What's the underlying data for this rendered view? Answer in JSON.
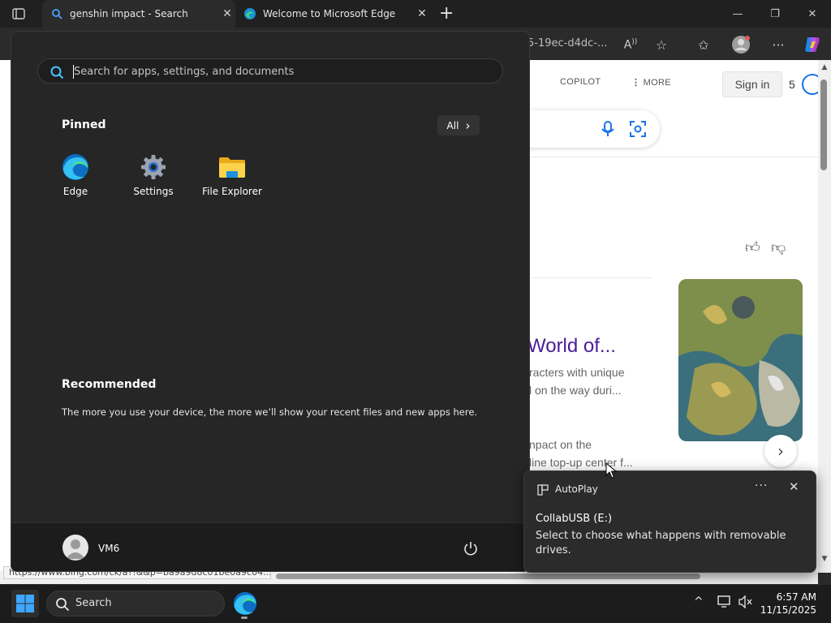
{
  "browser": {
    "tabs": [
      {
        "title": "genshin impact - Search",
        "close": "✕"
      },
      {
        "title": "Welcome to Microsoft Edge",
        "close": "✕"
      }
    ],
    "new_tab": "+",
    "address_fragment": "5-19ec-d4dc-...",
    "window_controls": {
      "minimize": "—",
      "restore": "❐",
      "close": "✕"
    },
    "toolbar_icons": [
      "read-aloud-icon",
      "favorite-star-icon",
      "favorites-icon",
      "profile-icon",
      "more-icon",
      "copilot-icon"
    ]
  },
  "webpage": {
    "nav": {
      "copilot": "COPILOT",
      "more": "MORE"
    },
    "signin": "Sign in",
    "rewards_count": "5",
    "result_title": "World of...",
    "snippet_line1": "racters with unique",
    "snippet_line2": "l on the way duri...",
    "snippet_line3": "npact on the",
    "snippet_line4": "line top-up center f...",
    "status_url": "https://www.bing.com/ck/a?!&&p=ba9a9d8c01be0a9c04...",
    "next_arrow": "›"
  },
  "start_menu": {
    "search_placeholder": "Search for apps, settings, and documents",
    "pinned_label": "Pinned",
    "all_label": "All",
    "all_chevron": "›",
    "pinned_apps": [
      {
        "label": "Edge",
        "icon": "edge-icon"
      },
      {
        "label": "Settings",
        "icon": "settings-gear-icon"
      },
      {
        "label": "File Explorer",
        "icon": "folder-icon"
      }
    ],
    "recommended_label": "Recommended",
    "recommended_text": "The more you use your device, the more we’ll show your recent files and new apps here.",
    "user_name": "VM6"
  },
  "toast": {
    "app": "AutoPlay",
    "more": "···",
    "close": "✕",
    "title": "CollabUSB (E:)",
    "body": "Select to choose what happens with removable drives."
  },
  "taskbar": {
    "search_label": "Search",
    "time": "6:57 AM",
    "date": "11/15/2025",
    "tray_chevron": "^"
  },
  "colors": {
    "start_bg": "#262626",
    "taskbar_bg": "#1c1c1c",
    "accent_blue": "#0078d4",
    "link_purple": "#4a1d96"
  }
}
